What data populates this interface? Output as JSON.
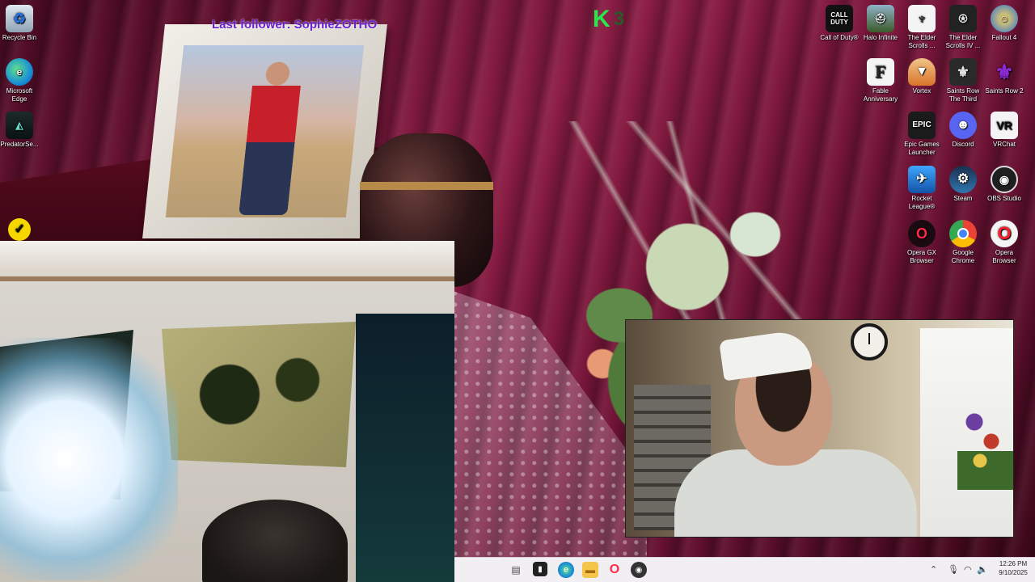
{
  "overlay": {
    "follower_text": "Last follower: SophieZOTHO",
    "logo_letter": "K",
    "logo_number": "3"
  },
  "desktop_icons": {
    "recycle_bin": "Recycle Bin",
    "edge": "Microsoft Edge",
    "predator": "PredatorSe...",
    "norton_check": "",
    "call_of_duty": "Call of Duty®",
    "halo": "Halo Infinite",
    "skyrim": "The Elder Scrolls ...",
    "oblivion": "The Elder Scrolls IV ...",
    "fallout4": "Fallout 4",
    "fable": "Fable Anniversary",
    "vortex": "Vortex",
    "saints_row_3": "Saints Row The Third",
    "saints_row_2": "Saints Row 2",
    "epic": "Epic Games Launcher",
    "discord": "Discord",
    "vrchat": "VRChat",
    "rocket_league": "Rocket League®",
    "steam": "Steam",
    "obs": "OBS Studio",
    "opera_gx": "Opera GX Browser",
    "chrome": "Google Chrome",
    "opera": "Opera Browser"
  },
  "icon_glyphs": {
    "call_of_duty": "CALL DUTY",
    "fable": "F",
    "epic": "EPIC",
    "vrchat": "VR"
  },
  "taskbar": {
    "clock_time": "12:26 PM",
    "clock_date": "9/10/2025"
  },
  "colors": {
    "overlay_text": "#6a1fd0",
    "logo_green": "#27e84a",
    "taskbar_bg": "#f2eff2"
  }
}
